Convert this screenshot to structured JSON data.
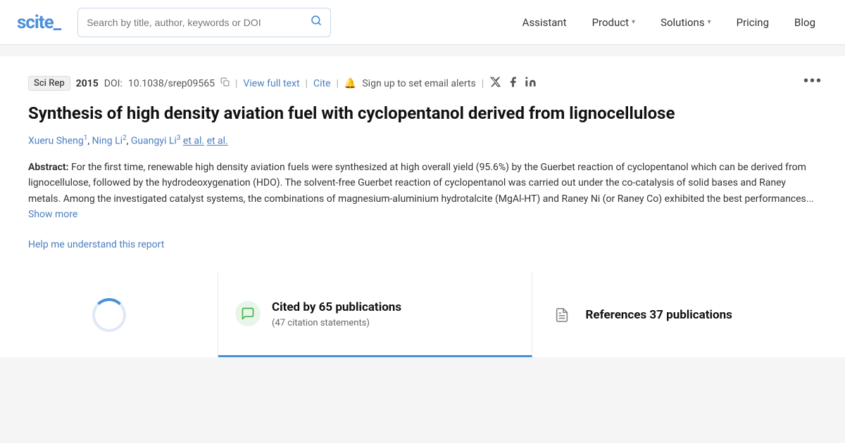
{
  "brand": {
    "logo_text": "scite_"
  },
  "navbar": {
    "search_placeholder": "Search by title, author, keywords or DOI",
    "items": [
      {
        "label": "Assistant",
        "has_chevron": false
      },
      {
        "label": "Product",
        "has_chevron": true
      },
      {
        "label": "Solutions",
        "has_chevron": true
      },
      {
        "label": "Pricing",
        "has_chevron": false
      },
      {
        "label": "Blog",
        "has_chevron": false
      }
    ]
  },
  "paper": {
    "journal": "Sci Rep",
    "year": "2015",
    "doi_label": "DOI:",
    "doi_value": "10.1038/srep09565",
    "view_full_text": "View full text",
    "cite": "Cite",
    "alert_text": "Sign up to set email alerts",
    "title": "Synthesis of high density aviation fuel with cyclopentanol derived from lignocellulose",
    "authors": [
      {
        "name": "Xueru Sheng",
        "sup": "1"
      },
      {
        "name": "Ning Li",
        "sup": "2"
      },
      {
        "name": "Guangyi Li",
        "sup": "3"
      }
    ],
    "et_al": "et al.",
    "abstract_label": "Abstract:",
    "abstract_body": "For the first time, renewable high density aviation fuels were synthesized at high overall yield (95.6%) by the Guerbet reaction of cyclopentanol which can be derived from lignocellulose, followed by the hydrodeoxygenation (HDO). The solvent-free Guerbet reaction of cyclopentanol was carried out under the co-catalysis of solid bases and Raney metals. Among the investigated catalyst systems, the combinations of magnesium-aluminium hydrotalcite (MgAl-HT) and Raney Ni (or Raney Co) exhibited the best performances...",
    "show_more": "Show more",
    "help_link": "Help me understand this report",
    "more_icon": "•••"
  },
  "cited_panel": {
    "main": "Cited by 65 publications",
    "sub": "(47 citation statements)"
  },
  "references_panel": {
    "main": "References 37 publications"
  },
  "social": {
    "twitter": "𝕏",
    "facebook": "f",
    "linkedin": "in"
  }
}
